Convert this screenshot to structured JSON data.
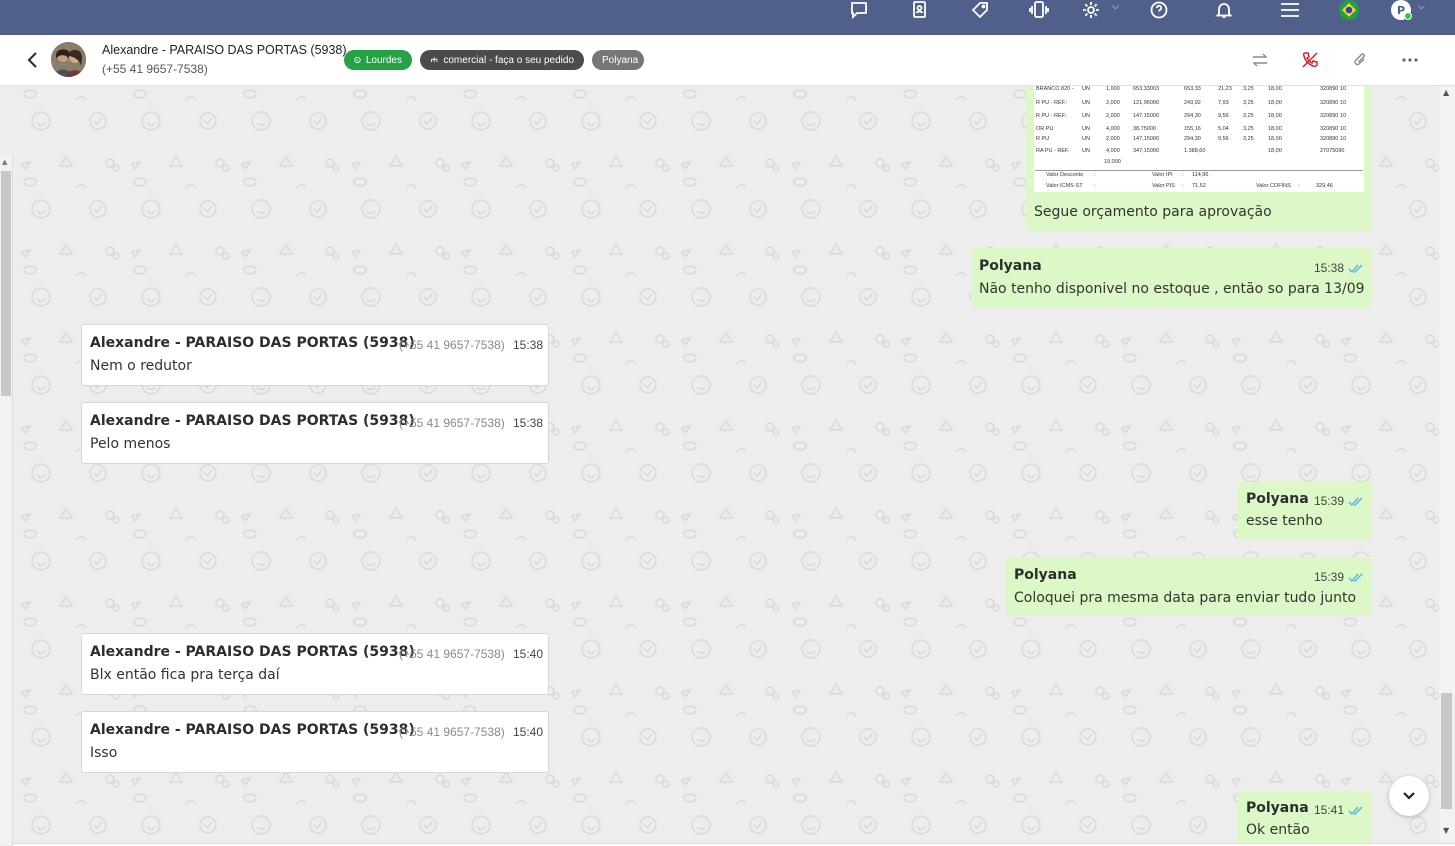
{
  "header": {
    "contact_name": "Alexandre - PARAISO DAS PORTAS (5938)",
    "contact_phone": "(+55 41 9657-7538)",
    "tags": [
      {
        "label": "Lourdes",
        "color": "#25a244"
      },
      {
        "label": "comercial - faça o seu pedido",
        "color": "#4b4b4b"
      },
      {
        "label": "Polyana",
        "color": "#777777"
      }
    ]
  },
  "topbar": {
    "user_initial": "P",
    "icons": [
      "chat-bubbles-icon",
      "contacts-book-icon",
      "tag-icon",
      "phone-vibrate-icon",
      "gear-icon",
      "help-icon",
      "bell-icon",
      "menu-icon",
      "brazil-flag-icon",
      "user-avatar"
    ]
  },
  "doc_preview": {
    "rows": [
      [
        "BRANCO 820 -",
        "UN",
        "1,000",
        "653,33003",
        "653,33",
        "21,23",
        "3,25",
        "18,00",
        "320890 10"
      ],
      [
        "R PU - REF.:",
        "UN",
        "2,000",
        "121,96000",
        "243,92",
        "7,93",
        "3,25",
        "18,00",
        "320890 10"
      ],
      [
        "R PU - REF.:",
        "UN",
        "2,000",
        "147,15000",
        "294,30",
        "9,56",
        "3,25",
        "18,00",
        "320890 10"
      ],
      [
        "OR PU",
        "UN",
        "4,000",
        "38,75000",
        "155,16",
        "5,04",
        "3,25",
        "18,00",
        "320890 10"
      ],
      [
        "R PU",
        "UN",
        "2,000",
        "147,15000",
        "294,30",
        "9,56",
        "3,25",
        "18,00",
        "320890 10"
      ],
      [
        "RA PU - REF.",
        "UN",
        "4,000",
        "347,15000",
        "1.388,60",
        "",
        "",
        "18,00",
        "27075090"
      ]
    ],
    "total_qty": "19,000",
    "footer": [
      {
        "label": "Valor Desconto",
        "sep": ":",
        "label2": "Valor IPI",
        "val2": "114,96"
      },
      {
        "label": "Valor ICMS-ST",
        "sep": ":",
        "label2": "Valor PIS",
        "val2": "71,52",
        "label3": "Valor COFINS",
        "val3": "329,46"
      }
    ]
  },
  "messages": [
    {
      "dir": "out",
      "sender": "",
      "time": "",
      "text": "Segue orçamento para aprovação"
    },
    {
      "dir": "out",
      "sender": "Polyana",
      "time": "15:38",
      "text": "Não tenho disponivel no estoque , então so para 13/09"
    },
    {
      "dir": "in",
      "sender": "Alexandre - PARAISO DAS PORTAS (5938)",
      "phone": "(+55 41 9657-7538)",
      "time": "15:38",
      "text": "Nem o redutor"
    },
    {
      "dir": "in",
      "sender": "Alexandre - PARAISO DAS PORTAS (5938)",
      "phone": "(+55 41 9657-7538)",
      "time": "15:38",
      "text": "Pelo menos"
    },
    {
      "dir": "out",
      "sender": "Polyana",
      "time": "15:39",
      "text": "esse tenho"
    },
    {
      "dir": "out",
      "sender": "Polyana",
      "time": "15:39",
      "text": "Coloquei pra mesma data para enviar tudo junto"
    },
    {
      "dir": "in",
      "sender": "Alexandre - PARAISO DAS PORTAS (5938)",
      "phone": "(+55 41 9657-7538)",
      "time": "15:40",
      "text": "Blx então fica pra terça daí"
    },
    {
      "dir": "in",
      "sender": "Alexandre - PARAISO DAS PORTAS (5938)",
      "phone": "(+55 41 9657-7538)",
      "time": "15:40",
      "text": "Isso"
    },
    {
      "dir": "out",
      "sender": "Polyana",
      "time": "15:41",
      "text": "Ok então"
    }
  ],
  "colors": {
    "topbar": "#50608a",
    "outgoing_bubble": "#dcf8c6",
    "incoming_bubble": "#ffffff",
    "read_check": "#4fb3e8"
  }
}
